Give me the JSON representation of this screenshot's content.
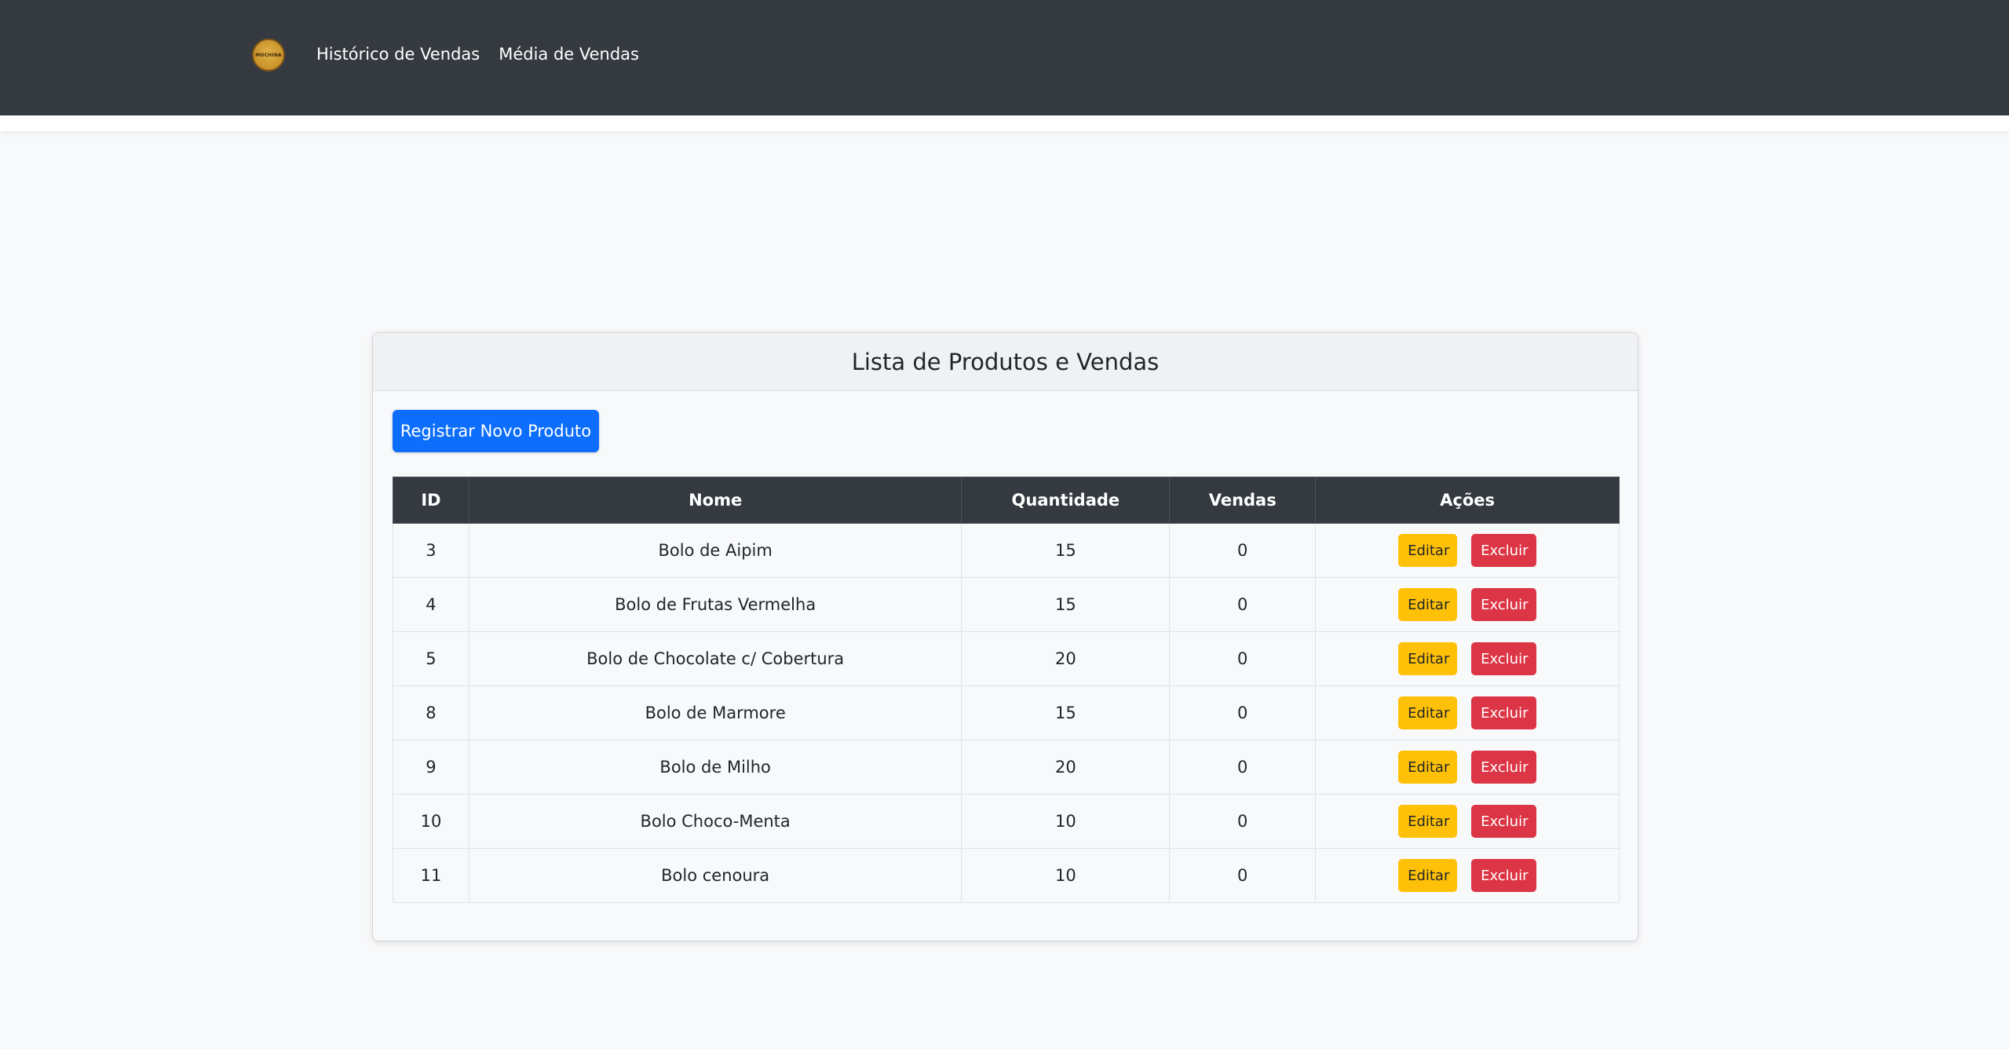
{
  "nav": {
    "logo_text": "MOCHINA",
    "links": [
      {
        "label": "Histórico de Vendas"
      },
      {
        "label": "Média de Vendas"
      }
    ]
  },
  "card": {
    "title": "Lista de Produtos e Vendas",
    "register_button": "Registrar Novo Produto"
  },
  "table": {
    "headers": [
      "ID",
      "Nome",
      "Quantidade",
      "Vendas",
      "Ações"
    ],
    "edit_label": "Editar",
    "delete_label": "Excluir",
    "rows": [
      {
        "id": "3",
        "nome": "Bolo de Aipim",
        "quantidade": "15",
        "vendas": "0"
      },
      {
        "id": "4",
        "nome": "Bolo de Frutas Vermelha",
        "quantidade": "15",
        "vendas": "0"
      },
      {
        "id": "5",
        "nome": "Bolo de Chocolate c/ Cobertura",
        "quantidade": "20",
        "vendas": "0"
      },
      {
        "id": "8",
        "nome": "Bolo de Marmore",
        "quantidade": "15",
        "vendas": "0"
      },
      {
        "id": "9",
        "nome": "Bolo de Milho",
        "quantidade": "20",
        "vendas": "0"
      },
      {
        "id": "10",
        "nome": "Bolo Choco-Menta",
        "quantidade": "10",
        "vendas": "0"
      },
      {
        "id": "11",
        "nome": "Bolo cenoura",
        "quantidade": "10",
        "vendas": "0"
      }
    ]
  },
  "colors": {
    "navbar": "#343a40",
    "primary": "#0d6efd",
    "warning": "#ffc107",
    "danger": "#dc3545"
  }
}
